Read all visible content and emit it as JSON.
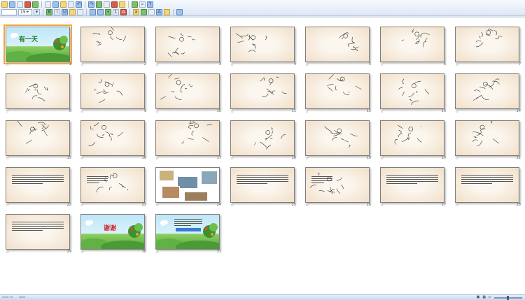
{
  "toolbar": {
    "font_size": "15+",
    "row1_icons": [
      "folder-open-icon",
      "save-icon",
      "print-icon",
      "preview-icon",
      "spell-icon",
      "cut-icon",
      "copy-icon",
      "paste-icon",
      "format-painter-icon",
      "undo-icon",
      "redo-icon",
      "hyperlink-icon",
      "table-icon",
      "chart-icon",
      "picture-icon",
      "slideshow-icon",
      "zoom-icon",
      "help-icon"
    ],
    "row2_icons": [
      "bold-icon",
      "italic-icon",
      "underline-icon",
      "shadow-icon",
      "align-left-icon",
      "align-center-icon",
      "align-right-icon",
      "bullets-icon",
      "numbering-icon",
      "increase-font-icon",
      "decrease-font-icon",
      "indent-icon",
      "outdent-icon",
      "font-color-icon",
      "design-icon",
      "new-slide-icon"
    ]
  },
  "slides": [
    {
      "num": "1",
      "kind": "nature",
      "title": "有一天",
      "title_color": "#1f7a2a"
    },
    {
      "num": "2",
      "kind": "sketch"
    },
    {
      "num": "3",
      "kind": "sketch"
    },
    {
      "num": "4",
      "kind": "sketch"
    },
    {
      "num": "5",
      "kind": "sketch"
    },
    {
      "num": "6",
      "kind": "sketch"
    },
    {
      "num": "7",
      "kind": "sketch"
    },
    {
      "num": "8",
      "kind": "sketch"
    },
    {
      "num": "9",
      "kind": "sketch"
    },
    {
      "num": "10",
      "kind": "sketch"
    },
    {
      "num": "11",
      "kind": "sketch"
    },
    {
      "num": "12",
      "kind": "sketch"
    },
    {
      "num": "13",
      "kind": "sketch"
    },
    {
      "num": "14",
      "kind": "sketch"
    },
    {
      "num": "15",
      "kind": "sketch"
    },
    {
      "num": "16",
      "kind": "sketch"
    },
    {
      "num": "17",
      "kind": "sketch"
    },
    {
      "num": "18",
      "kind": "sketch"
    },
    {
      "num": "19",
      "kind": "sketch"
    },
    {
      "num": "20",
      "kind": "sketch"
    },
    {
      "num": "21",
      "kind": "sketch"
    },
    {
      "num": "22",
      "kind": "text"
    },
    {
      "num": "23",
      "kind": "sketch-text"
    },
    {
      "num": "24",
      "kind": "photos"
    },
    {
      "num": "25",
      "kind": "text"
    },
    {
      "num": "26",
      "kind": "sketch-text"
    },
    {
      "num": "27",
      "kind": "text"
    },
    {
      "num": "28",
      "kind": "text"
    },
    {
      "num": "29",
      "kind": "text"
    },
    {
      "num": "30",
      "kind": "nature",
      "title": "谢谢",
      "title_color": "#d1242a"
    },
    {
      "num": "31",
      "kind": "nature-text"
    }
  ],
  "colors": {
    "accent": "#f2a93b",
    "status_bg": "#c9d8ec"
  }
}
